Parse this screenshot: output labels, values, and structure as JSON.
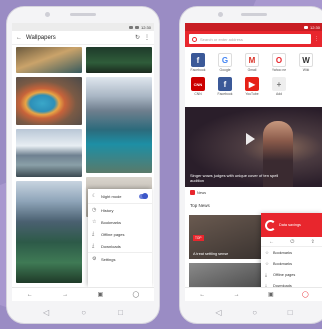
{
  "left_phone": {
    "app_title": "Wallpapers",
    "header_icons": [
      "refresh-icon",
      "more-vert-icon"
    ],
    "sheet_items": [
      {
        "label": "Night mode",
        "icon": "moon-icon",
        "toggle": true
      },
      {
        "label": "History",
        "icon": "clock-icon"
      },
      {
        "label": "Bookmarks",
        "icon": "star-icon"
      },
      {
        "label": "Offline pages",
        "icon": "download-icon"
      },
      {
        "label": "Downloads",
        "icon": "download-icon"
      },
      {
        "label": "Settings",
        "icon": "gear-icon"
      }
    ]
  },
  "right_phone": {
    "search_placeholder": "Search or enter address",
    "speed_dial": [
      {
        "label": "Facebook",
        "letter": "f",
        "color": "#3b5998"
      },
      {
        "label": "Google",
        "letter": "G",
        "color": "#ffffff"
      },
      {
        "label": "Gmail",
        "letter": "M",
        "color": "#ffffff"
      },
      {
        "label": "Yahoo ne",
        "letter": "O",
        "color": "#ffffff"
      },
      {
        "label": "Wiki",
        "letter": "W",
        "color": "#ffffff"
      },
      {
        "label": "CNN",
        "letter": "CNN",
        "color": "#cc0000"
      },
      {
        "label": "Facebook",
        "letter": "f",
        "color": "#3b5998"
      },
      {
        "label": "YouTube",
        "letter": "▶",
        "color": "#e62117"
      },
      {
        "label": "Add",
        "letter": "+",
        "color": "#eeeeee"
      }
    ],
    "video_caption": "Singer wows judges with unique cover of ten spell audition",
    "source_name": "News",
    "section_title": "Top News",
    "card_tag": "TOP",
    "card_caption": "A treat settling sense",
    "menu": {
      "head_title": "Data savings",
      "items": [
        {
          "label": "Bookmarks",
          "icon": "star-icon"
        },
        {
          "label": "Bookmarks",
          "icon": "star-icon"
        },
        {
          "label": "Offline pages",
          "icon": "download-icon"
        },
        {
          "label": "Downloads",
          "icon": "download-icon"
        }
      ]
    }
  },
  "colors": {
    "background": "#9a8cc4",
    "brand_red": "#e8262d",
    "accent_blue": "#3c57c9"
  }
}
